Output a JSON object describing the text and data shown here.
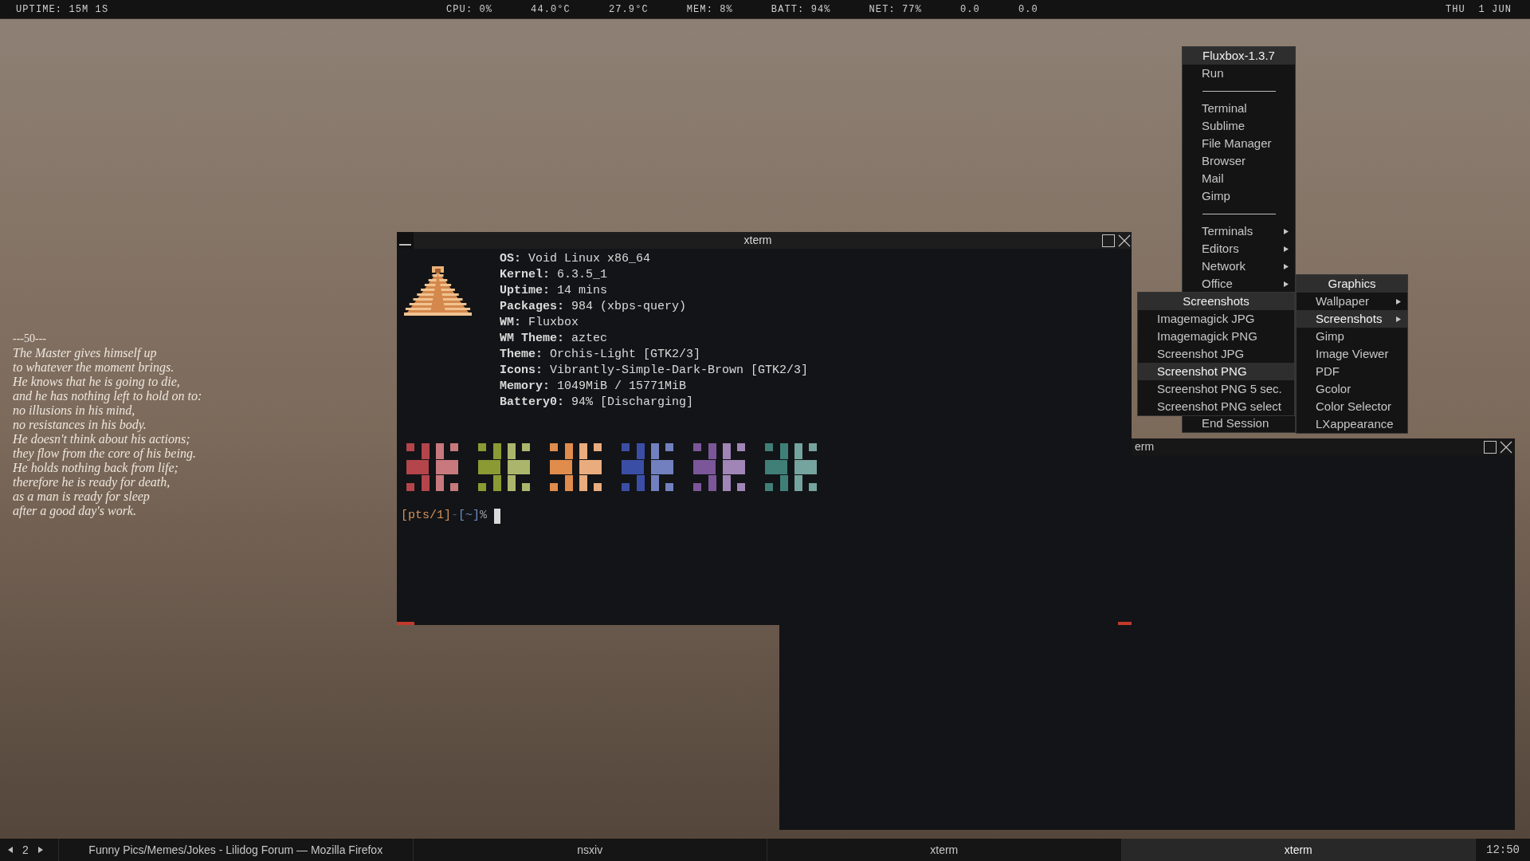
{
  "status_bar": {
    "uptime": "UPTIME: 15M 1S",
    "readings": [
      "CPU: 0%",
      "44.0°C",
      "27.9°C",
      "MEM: 8%",
      "BATT: 94%",
      "NET: 77%",
      "0.0",
      "0.0"
    ],
    "date": "THU  1 JUN"
  },
  "poem": {
    "heading": "---50---",
    "lines": [
      "The Master gives himself up",
      "to whatever the moment brings.",
      "He knows that he is going to die,",
      "and he has nothing left to hold on to:",
      "no illusions in his mind,",
      "no resistances in his body.",
      "He doesn't think about his actions;",
      "they flow from the core of his being.",
      "He holds nothing back from life;",
      "therefore he is ready for death,",
      "as a man is ready for sleep",
      "after a good day's work."
    ]
  },
  "windows": [
    {
      "title": "xterm",
      "info_lines": [
        "**OS:** Void Linux x86_64",
        "**Kernel:** 6.3.5_1",
        "**Uptime:** 14 mins",
        "**Packages:** 984 (xbps-query)",
        "**WM:** Fluxbox",
        "**WM Theme:** aztec",
        "**Theme:** Orchis-Light [GTK2/3]",
        "**Icons:** Vibrantly-Simple-Dark-Brown [GTK2/3]",
        "**Memory:** 1049MiB / 15771MiB",
        "**Battery0:** 94% [Discharging]"
      ],
      "palette": [
        {
          "color": "#b3454b"
        },
        {
          "color": "#8b9a33"
        },
        {
          "color": "#e08c4c"
        },
        {
          "color": "#3b4ea6"
        },
        {
          "color": "#7b5699"
        },
        {
          "color": "#3f7f78"
        }
      ],
      "prompt": [
        {
          "kind": "tty",
          "text": "[pts/1]"
        },
        {
          "kind": "dash",
          "text": "-"
        },
        {
          "kind": "cwd",
          "text": "[~]"
        },
        {
          "kind": "symbol",
          "text": "%"
        }
      ]
    },
    {
      "title": "erm"
    }
  ],
  "menus": [
    {
      "title": "Fluxbox-1.3.7",
      "items": [
        {
          "kind": "item",
          "label": "Run",
          "selected": false
        },
        {
          "kind": "separator"
        },
        {
          "kind": "item",
          "label": "Terminal",
          "selected": false
        },
        {
          "kind": "item",
          "label": "Sublime",
          "selected": false
        },
        {
          "kind": "item",
          "label": "File Manager",
          "selected": false
        },
        {
          "kind": "item",
          "label": "Browser",
          "selected": false
        },
        {
          "kind": "item",
          "label": "Mail",
          "selected": false
        },
        {
          "kind": "item",
          "label": "Gimp",
          "selected": false
        },
        {
          "kind": "separator"
        },
        {
          "kind": "submenu",
          "label": "Terminals",
          "selected": false
        },
        {
          "kind": "submenu",
          "label": "Editors",
          "selected": false
        },
        {
          "kind": "submenu",
          "label": "Network",
          "selected": false
        },
        {
          "kind": "submenu",
          "label": "Office",
          "selected": false
        }
      ],
      "bottom_items": [
        {
          "kind": "item",
          "label": "End Session",
          "selected": false
        }
      ]
    },
    {
      "title": "Screenshots",
      "items": [
        {
          "kind": "item",
          "label": "Imagemagick JPG",
          "selected": false
        },
        {
          "kind": "item",
          "label": "Imagemagick PNG",
          "selected": false
        },
        {
          "kind": "item",
          "label": "Screenshot JPG",
          "selected": false
        },
        {
          "kind": "item",
          "label": "Screenshot PNG",
          "selected": true
        },
        {
          "kind": "item",
          "label": "Screenshot PNG 5 sec.",
          "selected": false
        },
        {
          "kind": "item",
          "label": "Screenshot PNG select",
          "selected": false
        }
      ]
    },
    {
      "title": "Graphics",
      "items": [
        {
          "kind": "submenu",
          "label": "Wallpaper",
          "selected": false
        },
        {
          "kind": "submenu",
          "label": "Screenshots",
          "selected": true
        },
        {
          "kind": "item",
          "label": "Gimp",
          "selected": false
        },
        {
          "kind": "item",
          "label": "Image Viewer",
          "selected": false
        },
        {
          "kind": "item",
          "label": "PDF",
          "selected": false
        },
        {
          "kind": "item",
          "label": "Gcolor",
          "selected": false
        },
        {
          "kind": "item",
          "label": "Color Selector",
          "selected": false
        },
        {
          "kind": "item",
          "label": "LXappearance",
          "selected": false
        }
      ]
    }
  ],
  "taskbar": {
    "workspace": "2",
    "tasks": [
      {
        "label": "Funny Pics/Memes/Jokes - Lilidog Forum — Mozilla Firefox",
        "selected": false
      },
      {
        "label": "nsxiv",
        "selected": false
      },
      {
        "label": "xterm",
        "selected": false
      },
      {
        "label": "xterm",
        "selected": true
      }
    ],
    "clock": "12:50"
  }
}
